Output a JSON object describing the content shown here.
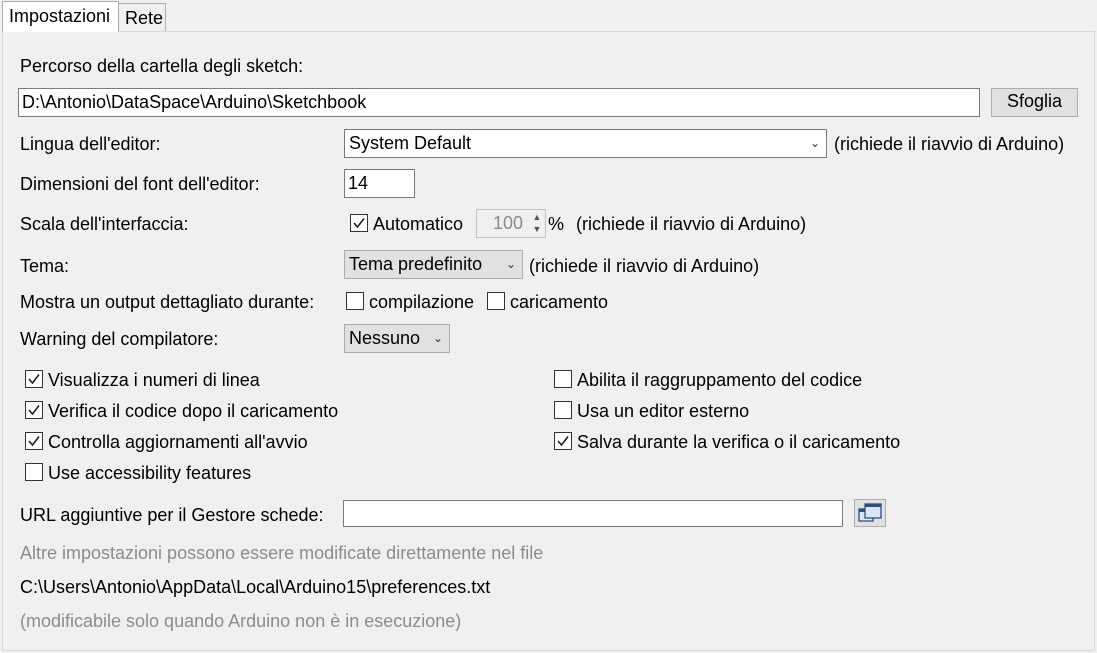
{
  "tabs": [
    {
      "label": "Impostazioni"
    },
    {
      "label": "Rete"
    }
  ],
  "sketchbook": {
    "label": "Percorso della cartella degli sketch:",
    "path": "D:\\Antonio\\DataSpace\\Arduino\\Sketchbook",
    "browse_label": "Sfoglia"
  },
  "editor_language": {
    "label": "Lingua dell'editor:",
    "value": "System Default",
    "note": "(richiede il riavvio di Arduino)"
  },
  "font_size": {
    "label": "Dimensioni del font dell'editor:",
    "value": "14"
  },
  "interface_scale": {
    "label": "Scala dell'interfaccia:",
    "auto_label": "Automatico",
    "auto_checked": true,
    "value": "100",
    "unit": "%",
    "note": "(richiede il riavvio di Arduino)"
  },
  "theme": {
    "label": "Tema:",
    "value": "Tema predefinito",
    "note": "(richiede il riavvio di Arduino)"
  },
  "verbose_output": {
    "label": "Mostra un output dettagliato durante:",
    "compile_label": "compilazione",
    "compile_checked": false,
    "upload_label": "caricamento",
    "upload_checked": false
  },
  "compiler_warnings": {
    "label": "Warning del compilatore:",
    "value": "Nessuno"
  },
  "options_left": [
    {
      "label": "Visualizza i numeri di linea",
      "checked": true
    },
    {
      "label": "Verifica il codice dopo il caricamento",
      "checked": true
    },
    {
      "label": "Controlla aggiornamenti all'avvio",
      "checked": true
    },
    {
      "label": "Use accessibility features",
      "checked": false
    }
  ],
  "options_right": [
    {
      "label": "Abilita il raggruppamento del codice",
      "checked": false
    },
    {
      "label": "Usa un editor esterno",
      "checked": false
    },
    {
      "label": "Salva durante la verifica o il caricamento",
      "checked": true
    }
  ],
  "board_urls": {
    "label": "URL aggiuntive per il Gestore schede:",
    "value": ""
  },
  "footer": {
    "more_info": "Altre impostazioni possono essere modificate direttamente nel file",
    "prefs_path": "C:\\Users\\Antonio\\AppData\\Local\\Arduino15\\preferences.txt",
    "edit_note": "(modificabile solo quando Arduino non è in esecuzione)"
  }
}
